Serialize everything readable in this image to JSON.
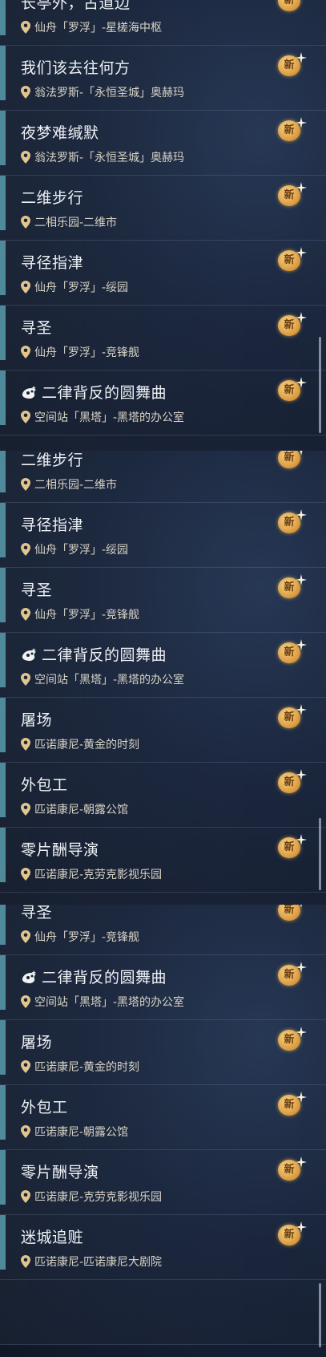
{
  "badge_label": "新",
  "colors": {
    "accent": "#4e8a9a",
    "badge": "#e8aa4b",
    "pin": "#e1c58d"
  },
  "panels": [
    {
      "items": [
        {
          "title": "长亭外，古道边",
          "location": "仙舟「罗浮」-星槎海中枢"
        },
        {
          "title": "我们该去往何方",
          "location": "翁法罗斯-「永恒圣城」奥赫玛"
        },
        {
          "title": "夜梦难缄默",
          "location": "翁法罗斯-「永恒圣城」奥赫玛"
        },
        {
          "title": "二维步行",
          "location": "二相乐园-二维市"
        },
        {
          "title": "寻径指津",
          "location": "仙舟「罗浮」-绥园"
        },
        {
          "title": "寻圣",
          "location": "仙舟「罗浮」-竞锋舰"
        },
        {
          "title": "二律背反的圆舞曲",
          "location": "空间站「黑塔」-黑塔的办公室",
          "icon": "event-mask-icon"
        }
      ]
    },
    {
      "items": [
        {
          "title": "二维步行",
          "location": "二相乐园-二维市"
        },
        {
          "title": "寻径指津",
          "location": "仙舟「罗浮」-绥园"
        },
        {
          "title": "寻圣",
          "location": "仙舟「罗浮」-竞锋舰"
        },
        {
          "title": "二律背反的圆舞曲",
          "location": "空间站「黑塔」-黑塔的办公室",
          "icon": "event-mask-icon"
        },
        {
          "title": "屠场",
          "location": "匹诺康尼-黄金的时刻"
        },
        {
          "title": "外包工",
          "location": "匹诺康尼-朝露公馆"
        },
        {
          "title": "零片酬导演",
          "location": "匹诺康尼-克劳克影视乐园"
        }
      ]
    },
    {
      "items": [
        {
          "title": "寻圣",
          "location": "仙舟「罗浮」-竞锋舰"
        },
        {
          "title": "二律背反的圆舞曲",
          "location": "空间站「黑塔」-黑塔的办公室",
          "icon": "event-mask-icon"
        },
        {
          "title": "屠场",
          "location": "匹诺康尼-黄金的时刻"
        },
        {
          "title": "外包工",
          "location": "匹诺康尼-朝露公馆"
        },
        {
          "title": "零片酬导演",
          "location": "匹诺康尼-克劳克影视乐园"
        },
        {
          "title": "迷城追赃",
          "location": "匹诺康尼-匹诺康尼大剧院"
        }
      ]
    }
  ]
}
